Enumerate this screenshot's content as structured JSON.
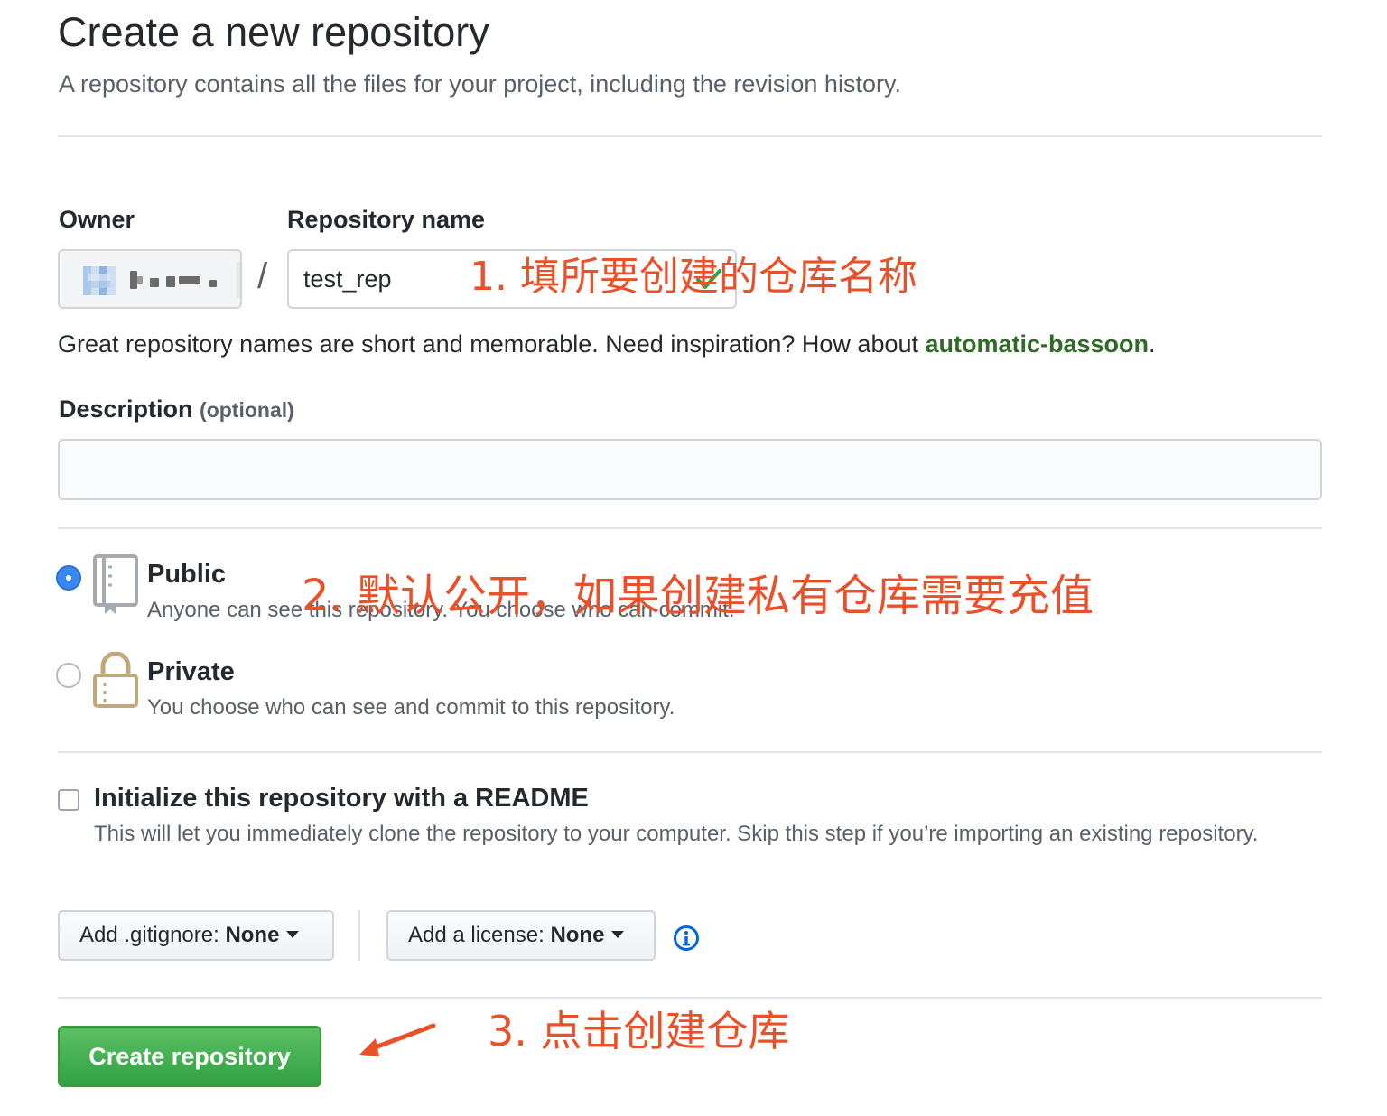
{
  "header": {
    "title": "Create a new repository",
    "subtitle": "A repository contains all the files for your project, including the revision history."
  },
  "form": {
    "owner_label": "Owner",
    "repo_name_label": "Repository name",
    "separator": "/",
    "repo_name_value": "test_rep",
    "hint_prefix": "Great repository names are short and memorable. Need inspiration? How about ",
    "hint_suggestion": "automatic-bassoon",
    "hint_suffix": ".",
    "description_label": "Description",
    "description_optional": "(optional)",
    "description_value": ""
  },
  "visibility": {
    "selected": "public",
    "public": {
      "title": "Public",
      "description": "Anyone can see this repository. You choose who can commit."
    },
    "private": {
      "title": "Private",
      "description": "You choose who can see and commit to this repository."
    }
  },
  "init": {
    "checked": false,
    "title": "Initialize this repository with a README",
    "description": "This will let you immediately clone the repository to your computer. Skip this step if you’re importing an existing repository."
  },
  "dropdowns": {
    "gitignore_prefix": "Add .gitignore: ",
    "gitignore_value": "None",
    "license_prefix": "Add a license: ",
    "license_value": "None"
  },
  "actions": {
    "create_label": "Create repository"
  },
  "annotations": {
    "step1": "1.  填所要创建的仓库名称",
    "step2": "2. 默认公开，如果创建私有仓库需要充值",
    "step3": "3. 点击创建仓库"
  },
  "colors": {
    "primary_button": "#34a143",
    "radio_selected": "#3b87f2",
    "suggestion_link": "#2f6b26",
    "annotation": "#e8512a"
  },
  "icons": {
    "public": "repo-book-icon",
    "private": "lock-icon",
    "valid": "check-icon",
    "info": "info-icon"
  }
}
